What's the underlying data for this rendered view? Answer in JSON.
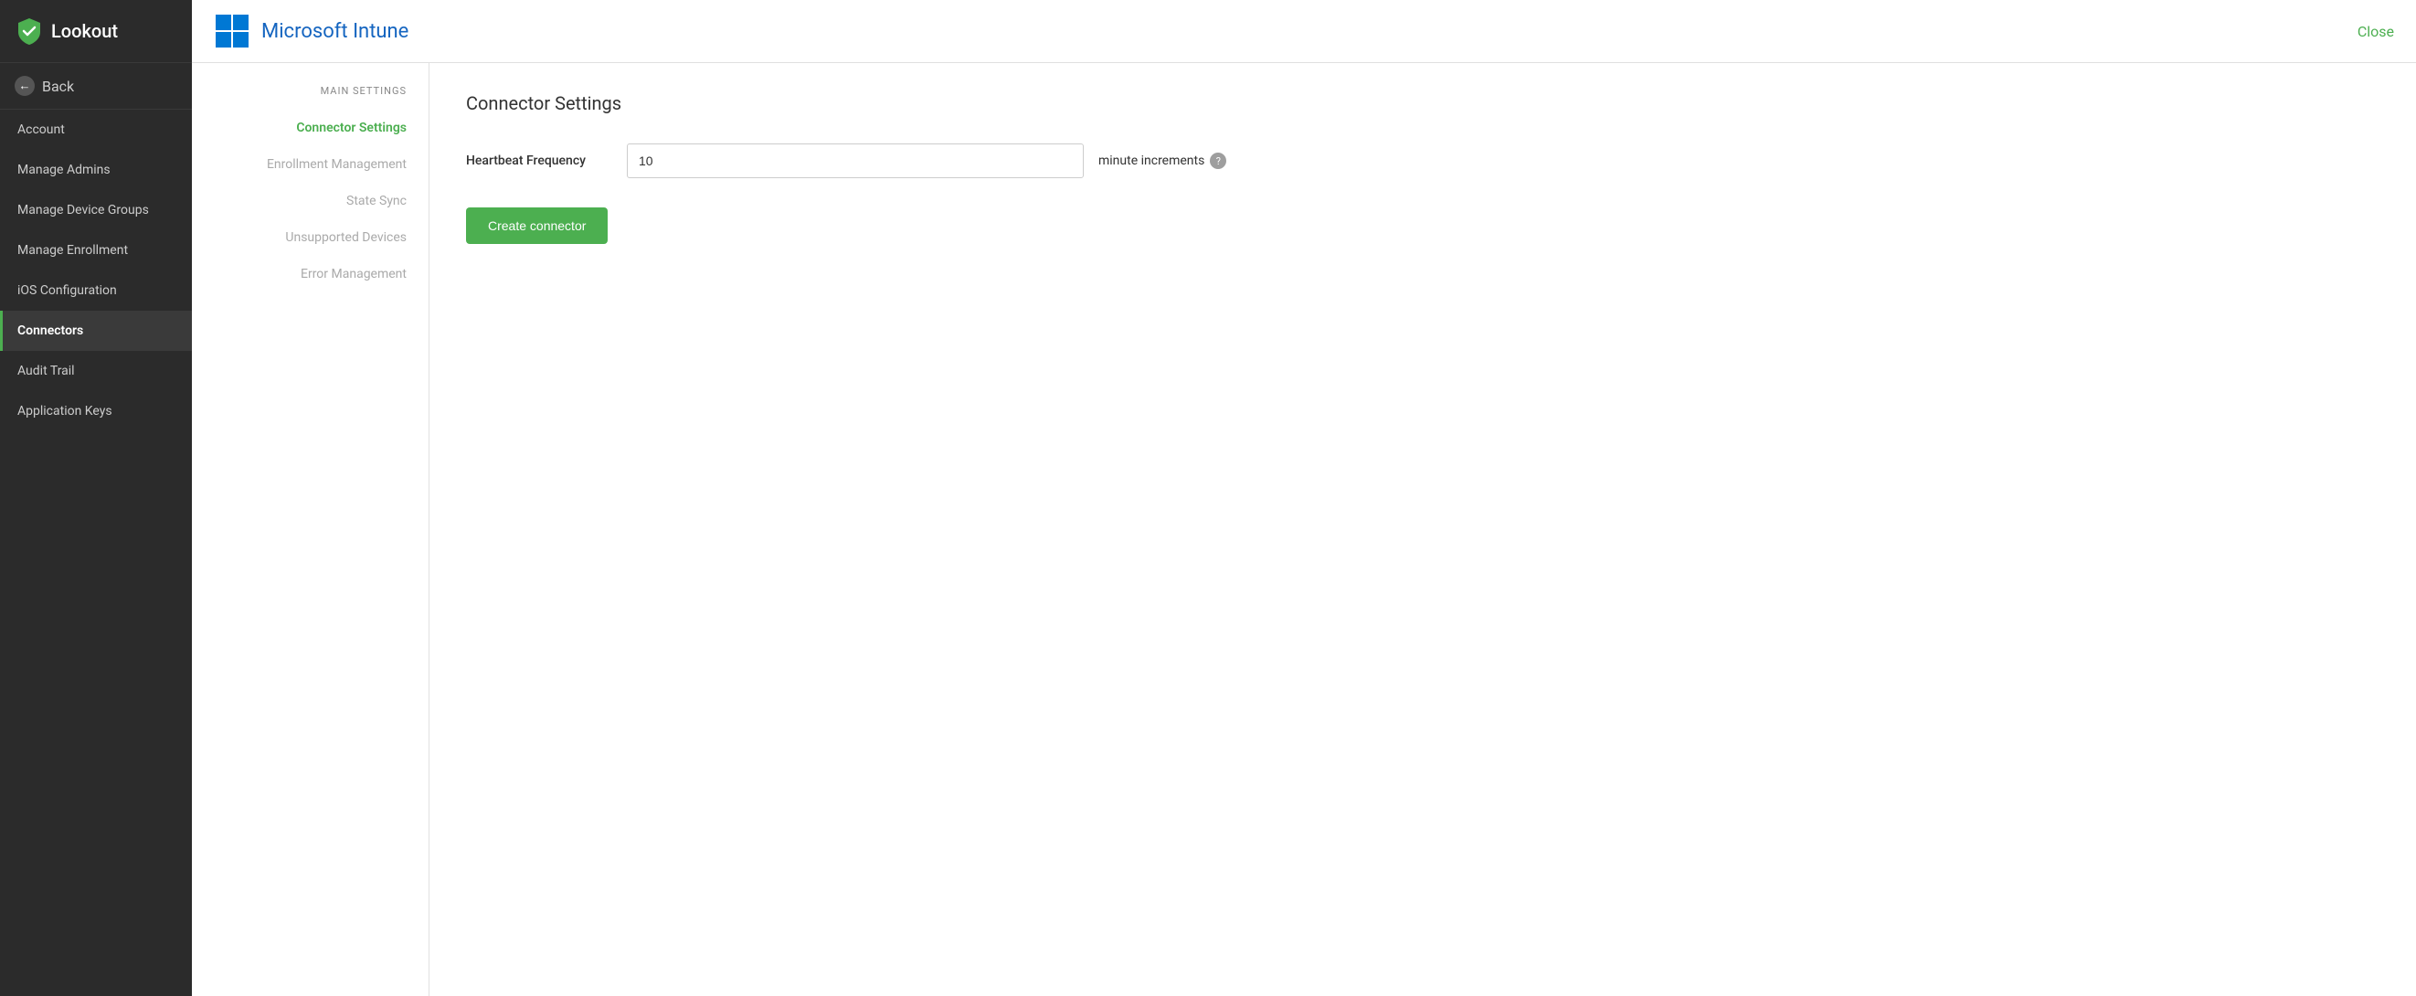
{
  "app": {
    "logo_text": "Lookout",
    "close_label": "Close"
  },
  "sidebar": {
    "back_label": "Back",
    "nav_items": [
      {
        "id": "account",
        "label": "Account",
        "active": false
      },
      {
        "id": "manage-admins",
        "label": "Manage Admins",
        "active": false
      },
      {
        "id": "manage-device-groups",
        "label": "Manage Device Groups",
        "active": false
      },
      {
        "id": "manage-enrollment",
        "label": "Manage Enrollment",
        "active": false
      },
      {
        "id": "ios-configuration",
        "label": "iOS Configuration",
        "active": false
      },
      {
        "id": "connectors",
        "label": "Connectors",
        "active": true
      },
      {
        "id": "audit-trail",
        "label": "Audit Trail",
        "active": false
      },
      {
        "id": "application-keys",
        "label": "Application Keys",
        "active": false
      }
    ]
  },
  "header": {
    "brand_title": "Microsoft Intune"
  },
  "settings_sidebar": {
    "section_label": "MAIN SETTINGS",
    "nav_items": [
      {
        "id": "connector-settings",
        "label": "Connector Settings",
        "active": true
      },
      {
        "id": "enrollment-management",
        "label": "Enrollment Management",
        "active": false
      },
      {
        "id": "state-sync",
        "label": "State Sync",
        "active": false
      },
      {
        "id": "unsupported-devices",
        "label": "Unsupported Devices",
        "active": false
      },
      {
        "id": "error-management",
        "label": "Error Management",
        "active": false
      }
    ]
  },
  "panel": {
    "title": "Connector Settings",
    "form": {
      "heartbeat_label": "Heartbeat Frequency",
      "heartbeat_value": "10",
      "heartbeat_unit": "minute increments",
      "create_btn_label": "Create connector"
    }
  }
}
